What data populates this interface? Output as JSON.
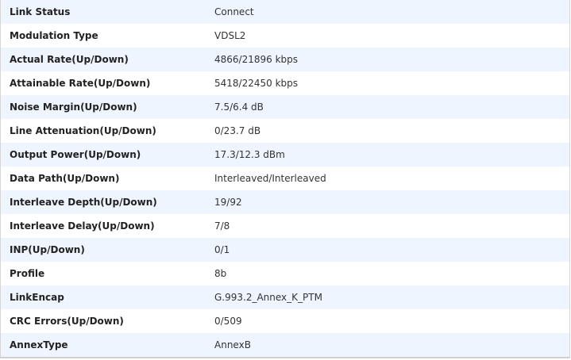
{
  "rows": [
    {
      "label": "Link Status",
      "value": "Connect"
    },
    {
      "label": "Modulation Type",
      "value": "VDSL2"
    },
    {
      "label": "Actual Rate(Up/Down)",
      "value": "4866/21896 kbps"
    },
    {
      "label": "Attainable Rate(Up/Down)",
      "value": "5418/22450 kbps"
    },
    {
      "label": "Noise Margin(Up/Down)",
      "value": "7.5/6.4 dB"
    },
    {
      "label": "Line Attenuation(Up/Down)",
      "value": "0/23.7 dB"
    },
    {
      "label": "Output Power(Up/Down)",
      "value": "17.3/12.3 dBm"
    },
    {
      "label": "Data Path(Up/Down)",
      "value": "Interleaved/Interleaved"
    },
    {
      "label": "Interleave Depth(Up/Down)",
      "value": "19/92"
    },
    {
      "label": "Interleave Delay(Up/Down)",
      "value": "7/8"
    },
    {
      "label": "INP(Up/Down)",
      "value": "0/1"
    },
    {
      "label": "Profile",
      "value": "8b"
    },
    {
      "label": "LinkEncap",
      "value": "G.993.2_Annex_K_PTM"
    },
    {
      "label": "CRC Errors(Up/Down)",
      "value": "0/509"
    },
    {
      "label": "AnnexType",
      "value": "AnnexB"
    }
  ]
}
